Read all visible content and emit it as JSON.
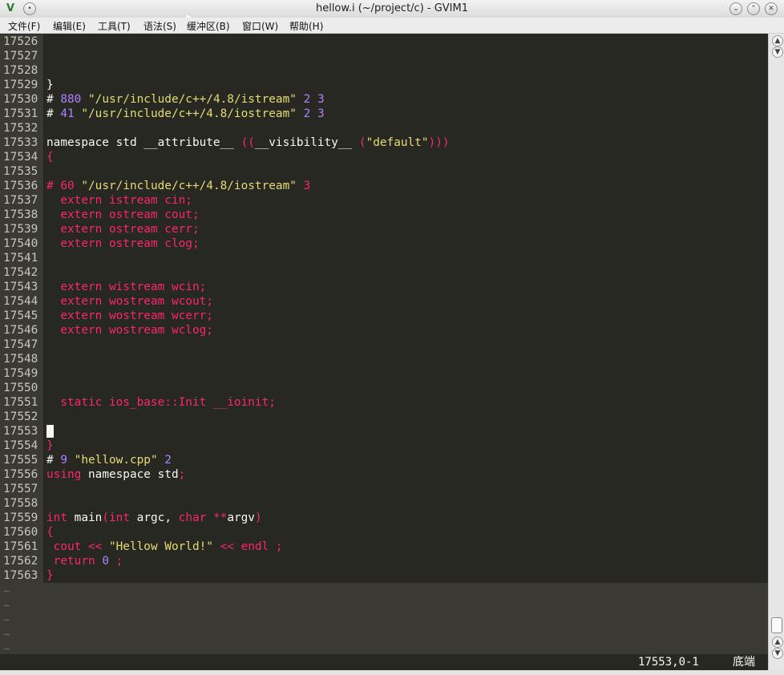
{
  "window": {
    "title": "hellow.i (~/project/c) - GVIM1",
    "app_icon": "vim-icon",
    "controls": [
      "minimize",
      "maximize",
      "close"
    ]
  },
  "menu": [
    "文件(F)",
    "编辑(E)",
    "工具(T)",
    "语法(S)",
    "缓冲区(B)",
    "窗口(W)",
    "帮助(H)"
  ],
  "editor": {
    "lines": [
      {
        "num": "17526",
        "tokens": []
      },
      {
        "num": "17527",
        "tokens": []
      },
      {
        "num": "17528",
        "tokens": []
      },
      {
        "num": "17529",
        "tokens": [
          {
            "t": "}",
            "c": "plain"
          }
        ]
      },
      {
        "num": "17530",
        "tokens": [
          {
            "t": "# ",
            "c": "plain"
          },
          {
            "t": "880",
            "c": "num"
          },
          {
            "t": " ",
            "c": "plain"
          },
          {
            "t": "\"/usr/include/c++/4.8/istream\"",
            "c": "str"
          },
          {
            "t": " ",
            "c": "plain"
          },
          {
            "t": "2",
            "c": "num"
          },
          {
            "t": " ",
            "c": "plain"
          },
          {
            "t": "3",
            "c": "num"
          }
        ]
      },
      {
        "num": "17531",
        "tokens": [
          {
            "t": "# ",
            "c": "plain"
          },
          {
            "t": "41",
            "c": "num"
          },
          {
            "t": " ",
            "c": "plain"
          },
          {
            "t": "\"/usr/include/c++/4.8/iostream\"",
            "c": "str"
          },
          {
            "t": " ",
            "c": "plain"
          },
          {
            "t": "2",
            "c": "num"
          },
          {
            "t": " ",
            "c": "plain"
          },
          {
            "t": "3",
            "c": "num"
          }
        ]
      },
      {
        "num": "17532",
        "tokens": []
      },
      {
        "num": "17533",
        "tokens": [
          {
            "t": "namespace std __attribute__ ",
            "c": "plain"
          },
          {
            "t": "((",
            "c": "kw"
          },
          {
            "t": "__visibility__ ",
            "c": "plain"
          },
          {
            "t": "(",
            "c": "kw"
          },
          {
            "t": "\"default\"",
            "c": "str"
          },
          {
            "t": ")))",
            "c": "kw"
          }
        ]
      },
      {
        "num": "17534",
        "tokens": [
          {
            "t": "{",
            "c": "kw"
          }
        ]
      },
      {
        "num": "17535",
        "tokens": []
      },
      {
        "num": "17536",
        "tokens": [
          {
            "t": "# 60 ",
            "c": "kw"
          },
          {
            "t": "\"/usr/include/c++/4.8/iostream\"",
            "c": "str"
          },
          {
            "t": " 3",
            "c": "kw"
          }
        ]
      },
      {
        "num": "17537",
        "tokens": [
          {
            "t": "  extern istream cin;",
            "c": "kw"
          }
        ]
      },
      {
        "num": "17538",
        "tokens": [
          {
            "t": "  extern ostream cout;",
            "c": "kw"
          }
        ]
      },
      {
        "num": "17539",
        "tokens": [
          {
            "t": "  extern ostream cerr;",
            "c": "kw"
          }
        ]
      },
      {
        "num": "17540",
        "tokens": [
          {
            "t": "  extern ostream clog;",
            "c": "kw"
          }
        ]
      },
      {
        "num": "17541",
        "tokens": []
      },
      {
        "num": "17542",
        "tokens": []
      },
      {
        "num": "17543",
        "tokens": [
          {
            "t": "  extern wistream wcin;",
            "c": "kw"
          }
        ]
      },
      {
        "num": "17544",
        "tokens": [
          {
            "t": "  extern wostream wcout;",
            "c": "kw"
          }
        ]
      },
      {
        "num": "17545",
        "tokens": [
          {
            "t": "  extern wostream wcerr;",
            "c": "kw"
          }
        ]
      },
      {
        "num": "17546",
        "tokens": [
          {
            "t": "  extern wostream wclog;",
            "c": "kw"
          }
        ]
      },
      {
        "num": "17547",
        "tokens": []
      },
      {
        "num": "17548",
        "tokens": []
      },
      {
        "num": "17549",
        "tokens": []
      },
      {
        "num": "17550",
        "tokens": []
      },
      {
        "num": "17551",
        "tokens": [
          {
            "t": "  static ios_base::Init __ioinit;",
            "c": "kw"
          }
        ]
      },
      {
        "num": "17552",
        "tokens": []
      },
      {
        "num": "17553",
        "tokens": [],
        "cursor": true
      },
      {
        "num": "17554",
        "tokens": [
          {
            "t": "}",
            "c": "kw"
          }
        ]
      },
      {
        "num": "17555",
        "tokens": [
          {
            "t": "# ",
            "c": "plain"
          },
          {
            "t": "9",
            "c": "num"
          },
          {
            "t": " ",
            "c": "plain"
          },
          {
            "t": "\"hellow.cpp\"",
            "c": "str"
          },
          {
            "t": " ",
            "c": "plain"
          },
          {
            "t": "2",
            "c": "num"
          }
        ]
      },
      {
        "num": "17556",
        "tokens": [
          {
            "t": "using",
            "c": "kw"
          },
          {
            "t": " namespace std",
            "c": "plain"
          },
          {
            "t": ";",
            "c": "kw"
          }
        ]
      },
      {
        "num": "17557",
        "tokens": []
      },
      {
        "num": "17558",
        "tokens": []
      },
      {
        "num": "17559",
        "tokens": [
          {
            "t": "int",
            "c": "kw"
          },
          {
            "t": " main",
            "c": "plain"
          },
          {
            "t": "(",
            "c": "kw"
          },
          {
            "t": "int",
            "c": "kw"
          },
          {
            "t": " argc, ",
            "c": "plain"
          },
          {
            "t": "char",
            "c": "kw"
          },
          {
            "t": " ",
            "c": "plain"
          },
          {
            "t": "**",
            "c": "kw"
          },
          {
            "t": "argv",
            "c": "plain"
          },
          {
            "t": ")",
            "c": "kw"
          }
        ]
      },
      {
        "num": "17560",
        "tokens": [
          {
            "t": "{",
            "c": "kw"
          }
        ]
      },
      {
        "num": "17561",
        "tokens": [
          {
            "t": " cout << ",
            "c": "kw"
          },
          {
            "t": "\"Hellow World!\"",
            "c": "str"
          },
          {
            "t": " << endl ;",
            "c": "kw"
          }
        ]
      },
      {
        "num": "17562",
        "tokens": [
          {
            "t": " return ",
            "c": "kw"
          },
          {
            "t": "0",
            "c": "num"
          },
          {
            "t": " ;",
            "c": "kw"
          }
        ]
      },
      {
        "num": "17563",
        "tokens": [
          {
            "t": "}",
            "c": "kw"
          }
        ]
      }
    ],
    "tildes": [
      "~",
      "~",
      "~",
      "~",
      "~"
    ]
  },
  "status": {
    "position": "17553,0-1",
    "percent": "底端"
  },
  "colors": {
    "background": "#272822",
    "gutter": "#3b3a32",
    "keyword": "#f92672",
    "string": "#e6db74",
    "number": "#ae81ff",
    "text": "#f8f8f2"
  }
}
